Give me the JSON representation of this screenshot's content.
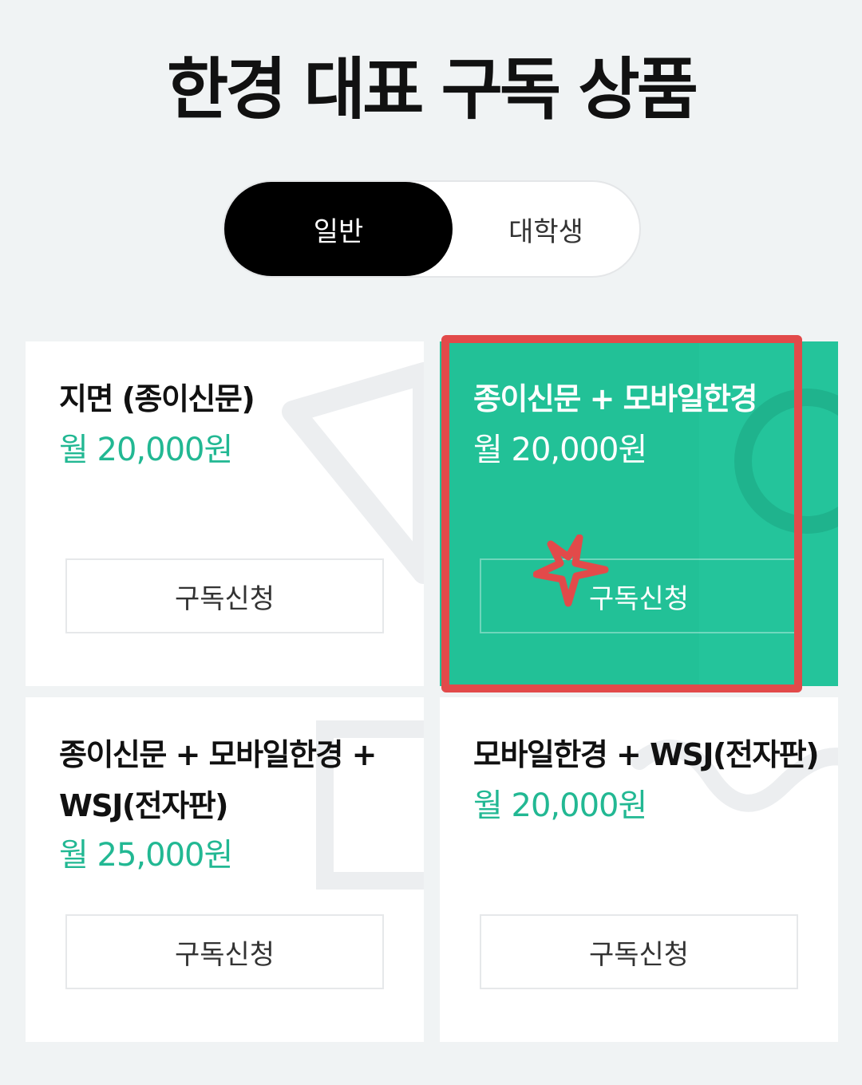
{
  "header": {
    "title": "한경 대표 구독 상품"
  },
  "toggle": {
    "options": [
      {
        "label": "일반",
        "selected": true
      },
      {
        "label": "대학생",
        "selected": false
      }
    ]
  },
  "products": [
    {
      "name": "지면 (종이신문)",
      "price": "월 20,000원",
      "button": "구독신청"
    },
    {
      "name": "종이신문 + 모바일한경",
      "price": "월 20,000원",
      "button": "구독신청"
    },
    {
      "name": "종이신문 + 모바일한경 + WSJ(전자판)",
      "price": "월 25,000원",
      "button": "구독신청"
    },
    {
      "name": "모바일한경 + WSJ(전자판)",
      "price": "월 20,000원",
      "button": "구독신청"
    }
  ],
  "colors": {
    "accent": "#22c197",
    "price_text": "#22b893",
    "highlight": "#e24a4a",
    "toggle_active": "#000000"
  }
}
